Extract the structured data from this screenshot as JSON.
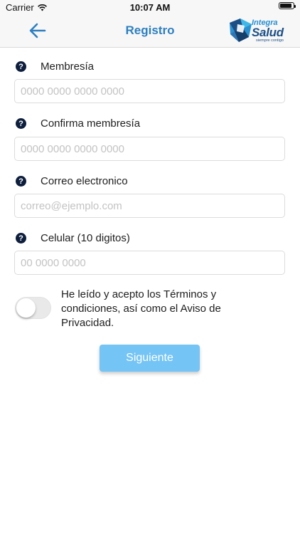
{
  "status_bar": {
    "carrier": "Carrier",
    "time": "10:07 AM",
    "battery_level": 0.9
  },
  "nav": {
    "title": "Registro",
    "back_icon": "arrow-left-icon",
    "logo_line1": "Integra",
    "logo_line2": "Salud",
    "logo_tagline": "siempre contigo"
  },
  "form": {
    "fields": [
      {
        "label": "Membresía",
        "placeholder": "0000 0000 0000 0000",
        "value": ""
      },
      {
        "label": "Confirma membresía",
        "placeholder": "0000 0000 0000 0000",
        "value": ""
      },
      {
        "label": "Correo electronico",
        "placeholder": "correo@ejemplo.com",
        "value": ""
      },
      {
        "label": "Celular (10 digitos)",
        "placeholder": "00 0000 0000",
        "value": ""
      }
    ],
    "help_glyph": "?",
    "terms": {
      "text": "He leído y acepto los Términos y condiciones, así como el Aviso de Privacidad.",
      "accepted": false
    },
    "submit_label": "Siguiente"
  },
  "colors": {
    "accent": "#2d7fc1",
    "button": "#74c4f5",
    "help_icon": "#0e1f3d"
  }
}
